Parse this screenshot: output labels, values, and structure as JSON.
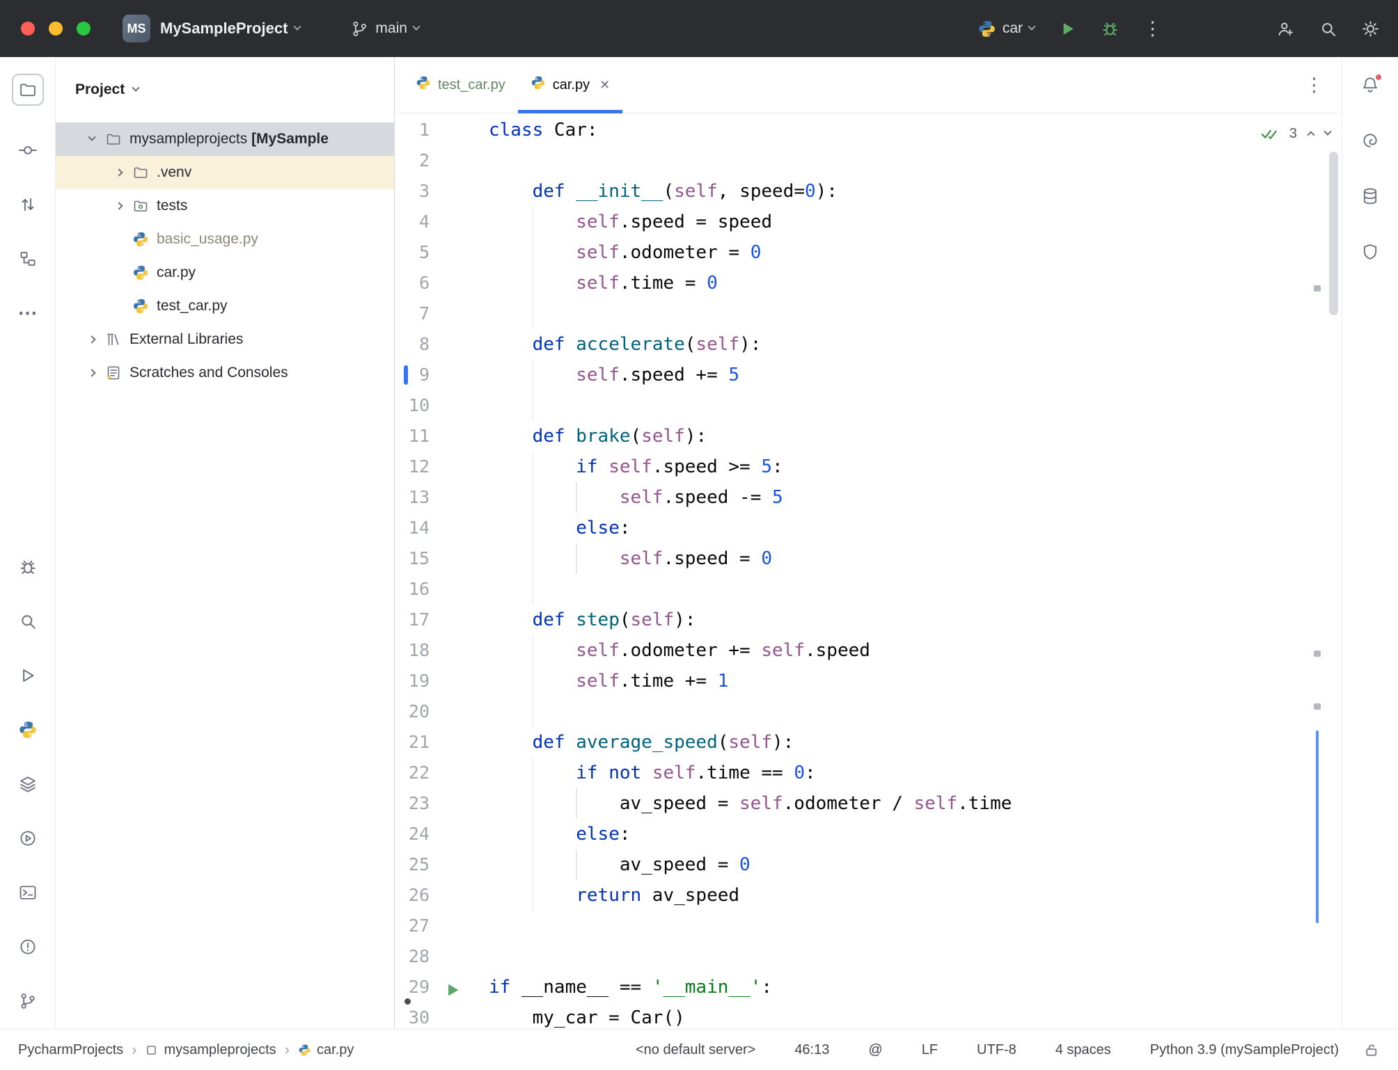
{
  "colors": {
    "accent": "#3574f0",
    "run_green": "#59a869",
    "keyword": "#0033b3",
    "self_ref": "#94558d",
    "number": "#1750eb",
    "string": "#067d17",
    "function_name": "#00627a",
    "titlebar_bg": "#2b2d30"
  },
  "title_bar": {
    "project_badge": "MS",
    "project_name": "MySampleProject",
    "branch_name": "main",
    "run_config": "car",
    "icons": [
      "traffic-close",
      "traffic-minimize",
      "traffic-zoom",
      "branch-icon",
      "python-icon",
      "run-icon",
      "debug-icon",
      "more-icon",
      "add-user-icon",
      "search-icon",
      "settings-icon"
    ]
  },
  "left_toolbar": {
    "icons_top": [
      "project-folder",
      "commit",
      "pull-requests",
      "structure",
      "more"
    ],
    "icons_bottom": [
      "debug",
      "search-everywhere",
      "run",
      "python-packages",
      "services",
      "run-anything",
      "terminal",
      "problems",
      "version-control"
    ]
  },
  "right_toolbar": {
    "icons": [
      "notifications-bell",
      "ai-assistant",
      "database",
      "shield"
    ]
  },
  "project_panel": {
    "header": "Project",
    "tree": [
      {
        "label": "mysampleprojects",
        "suffix": "[MySample",
        "icon": "folder",
        "chevron": "down",
        "indent": 0,
        "bg": "selected"
      },
      {
        "label": ".venv",
        "icon": "folder",
        "chevron": "right",
        "indent": 1,
        "bg": "cream"
      },
      {
        "label": "tests",
        "icon": "folder-test",
        "chevron": "right",
        "indent": 1
      },
      {
        "label": "basic_usage.py",
        "icon": "python",
        "indent": 1,
        "dim": true
      },
      {
        "label": "car.py",
        "icon": "python",
        "indent": 1
      },
      {
        "label": "test_car.py",
        "icon": "python",
        "indent": 1
      },
      {
        "label": "External Libraries",
        "icon": "libraries",
        "chevron": "right",
        "indent": 0
      },
      {
        "label": "Scratches and Consoles",
        "icon": "scratches",
        "chevron": "right",
        "indent": 0
      }
    ]
  },
  "tabs": [
    {
      "label": "test_car.py",
      "icon": "python",
      "active": false,
      "label_color": "#5f8563",
      "closable": false
    },
    {
      "label": "car.py",
      "icon": "python",
      "active": true,
      "closable": true
    }
  ],
  "inspections": {
    "count": "3"
  },
  "editor": {
    "change_bar_line": 9,
    "run_line": 29,
    "lines": [
      {
        "n": 1,
        "t": [
          [
            "k",
            "class"
          ],
          [
            "p",
            " Car:"
          ]
        ]
      },
      {
        "n": 2,
        "t": []
      },
      {
        "n": 3,
        "t": [
          [
            "p",
            "    "
          ],
          [
            "k",
            "def"
          ],
          [
            "p",
            " "
          ],
          [
            "fn",
            "__init__"
          ],
          [
            "p",
            "("
          ],
          [
            "s",
            "self"
          ],
          [
            "p",
            ", speed="
          ],
          [
            "n",
            "0"
          ],
          [
            "p",
            "):"
          ]
        ]
      },
      {
        "n": 4,
        "g": [
          4
        ],
        "t": [
          [
            "p",
            "        "
          ],
          [
            "s",
            "self"
          ],
          [
            "p",
            ".speed = speed"
          ]
        ]
      },
      {
        "n": 5,
        "g": [
          4
        ],
        "t": [
          [
            "p",
            "        "
          ],
          [
            "s",
            "self"
          ],
          [
            "p",
            ".odometer = "
          ],
          [
            "n",
            "0"
          ]
        ]
      },
      {
        "n": 6,
        "g": [
          4
        ],
        "t": [
          [
            "p",
            "        "
          ],
          [
            "s",
            "self"
          ],
          [
            "p",
            ".time = "
          ],
          [
            "n",
            "0"
          ]
        ]
      },
      {
        "n": 7,
        "g": [
          4
        ],
        "t": []
      },
      {
        "n": 8,
        "t": [
          [
            "p",
            "    "
          ],
          [
            "k",
            "def"
          ],
          [
            "p",
            " "
          ],
          [
            "fn",
            "accelerate"
          ],
          [
            "p",
            "("
          ],
          [
            "s",
            "self"
          ],
          [
            "p",
            "):"
          ]
        ]
      },
      {
        "n": 9,
        "g": [
          4
        ],
        "t": [
          [
            "p",
            "        "
          ],
          [
            "s",
            "self"
          ],
          [
            "p",
            ".speed += "
          ],
          [
            "n",
            "5"
          ]
        ]
      },
      {
        "n": 10,
        "g": [
          4
        ],
        "t": []
      },
      {
        "n": 11,
        "t": [
          [
            "p",
            "    "
          ],
          [
            "k",
            "def"
          ],
          [
            "p",
            " "
          ],
          [
            "fn",
            "brake"
          ],
          [
            "p",
            "("
          ],
          [
            "s",
            "self"
          ],
          [
            "p",
            "):"
          ]
        ]
      },
      {
        "n": 12,
        "g": [
          4
        ],
        "t": [
          [
            "p",
            "        "
          ],
          [
            "k",
            "if"
          ],
          [
            "p",
            " "
          ],
          [
            "s",
            "self"
          ],
          [
            "p",
            ".speed >= "
          ],
          [
            "n",
            "5"
          ],
          [
            "p",
            ":"
          ]
        ]
      },
      {
        "n": 13,
        "g": [
          4,
          8
        ],
        "t": [
          [
            "p",
            "            "
          ],
          [
            "s",
            "self"
          ],
          [
            "p",
            ".speed -= "
          ],
          [
            "n",
            "5"
          ]
        ]
      },
      {
        "n": 14,
        "g": [
          4
        ],
        "t": [
          [
            "p",
            "        "
          ],
          [
            "k",
            "else"
          ],
          [
            "p",
            ":"
          ]
        ]
      },
      {
        "n": 15,
        "g": [
          4,
          8
        ],
        "t": [
          [
            "p",
            "            "
          ],
          [
            "s",
            "self"
          ],
          [
            "p",
            ".speed = "
          ],
          [
            "n",
            "0"
          ]
        ]
      },
      {
        "n": 16,
        "g": [
          4
        ],
        "t": []
      },
      {
        "n": 17,
        "t": [
          [
            "p",
            "    "
          ],
          [
            "k",
            "def"
          ],
          [
            "p",
            " "
          ],
          [
            "fn",
            "step"
          ],
          [
            "p",
            "("
          ],
          [
            "s",
            "self"
          ],
          [
            "p",
            "):"
          ]
        ]
      },
      {
        "n": 18,
        "g": [
          4
        ],
        "t": [
          [
            "p",
            "        "
          ],
          [
            "s",
            "self"
          ],
          [
            "p",
            ".odometer += "
          ],
          [
            "s",
            "self"
          ],
          [
            "p",
            ".speed"
          ]
        ]
      },
      {
        "n": 19,
        "g": [
          4
        ],
        "t": [
          [
            "p",
            "        "
          ],
          [
            "s",
            "self"
          ],
          [
            "p",
            ".time += "
          ],
          [
            "n",
            "1"
          ]
        ]
      },
      {
        "n": 20,
        "g": [
          4
        ],
        "t": []
      },
      {
        "n": 21,
        "t": [
          [
            "p",
            "    "
          ],
          [
            "k",
            "def"
          ],
          [
            "p",
            " "
          ],
          [
            "fn",
            "average_speed"
          ],
          [
            "p",
            "("
          ],
          [
            "s",
            "self"
          ],
          [
            "p",
            "):"
          ]
        ]
      },
      {
        "n": 22,
        "g": [
          4
        ],
        "t": [
          [
            "p",
            "        "
          ],
          [
            "k",
            "if"
          ],
          [
            "p",
            " "
          ],
          [
            "k",
            "not"
          ],
          [
            "p",
            " "
          ],
          [
            "s",
            "self"
          ],
          [
            "p",
            ".time == "
          ],
          [
            "n",
            "0"
          ],
          [
            "p",
            ":"
          ]
        ]
      },
      {
        "n": 23,
        "g": [
          4,
          8
        ],
        "t": [
          [
            "p",
            "            av_speed = "
          ],
          [
            "s",
            "self"
          ],
          [
            "p",
            ".odometer / "
          ],
          [
            "s",
            "self"
          ],
          [
            "p",
            ".time"
          ]
        ]
      },
      {
        "n": 24,
        "g": [
          4
        ],
        "t": [
          [
            "p",
            "        "
          ],
          [
            "k",
            "else"
          ],
          [
            "p",
            ":"
          ]
        ]
      },
      {
        "n": 25,
        "g": [
          4,
          8
        ],
        "t": [
          [
            "p",
            "            av_speed = "
          ],
          [
            "n",
            "0"
          ]
        ]
      },
      {
        "n": 26,
        "g": [
          4
        ],
        "t": [
          [
            "p",
            "        "
          ],
          [
            "k",
            "return"
          ],
          [
            "p",
            " av_speed"
          ]
        ]
      },
      {
        "n": 27,
        "t": []
      },
      {
        "n": 28,
        "t": []
      },
      {
        "n": 29,
        "run": true,
        "t": [
          [
            "k",
            "if"
          ],
          [
            "p",
            " __name__ == "
          ],
          [
            "str",
            "'__main__'"
          ],
          [
            "p",
            ":"
          ]
        ]
      },
      {
        "n": 30,
        "t": [
          [
            "p",
            "    my_car = Car()"
          ]
        ]
      }
    ]
  },
  "status_bar": {
    "breadcrumbs": [
      {
        "label": "PycharmProjects"
      },
      {
        "label": "mysampleprojects",
        "icon": "module"
      },
      {
        "label": "car.py",
        "icon": "python"
      }
    ],
    "items": [
      "<no default server>",
      "46:13",
      "@",
      "LF",
      "UTF-8",
      "4 spaces",
      "Python 3.9 (mySampleProject)"
    ],
    "lock_icon": "unlocked"
  }
}
